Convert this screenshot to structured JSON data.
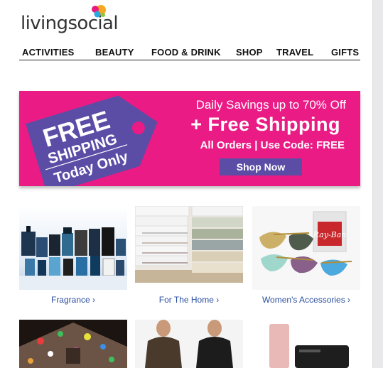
{
  "header": {
    "logo_text": "livingsocial"
  },
  "nav": {
    "items": [
      {
        "label": "ACTIVITIES"
      },
      {
        "label": "BEAUTY"
      },
      {
        "label": "FOOD & DRINK"
      },
      {
        "label": "SHOP"
      },
      {
        "label": "TRAVEL"
      },
      {
        "label": "GIFTS"
      }
    ]
  },
  "banner": {
    "tag_line1": "FREE",
    "tag_line2": "SHIPPING",
    "tag_line3": "Today Only",
    "headline_small": "Daily Savings up to 70% Off",
    "headline_big": "+ Free Shipping",
    "code_line": "All Orders | Use Code: FREE",
    "cta_label": "Shop Now",
    "bg_color": "#ea1b85",
    "tag_color": "#5b4da6"
  },
  "categories": [
    {
      "label": "Fragrance ›",
      "icon": "fragrance-bottles-image"
    },
    {
      "label": "For The Home ›",
      "icon": "folded-sheets-image"
    },
    {
      "label": "Women's Accessories ›",
      "icon": "sunglasses-image"
    }
  ],
  "second_row": [
    {
      "icon": "holiday-lights-house-image"
    },
    {
      "icon": "leather-jackets-image"
    },
    {
      "icon": "power-bank-image"
    }
  ]
}
